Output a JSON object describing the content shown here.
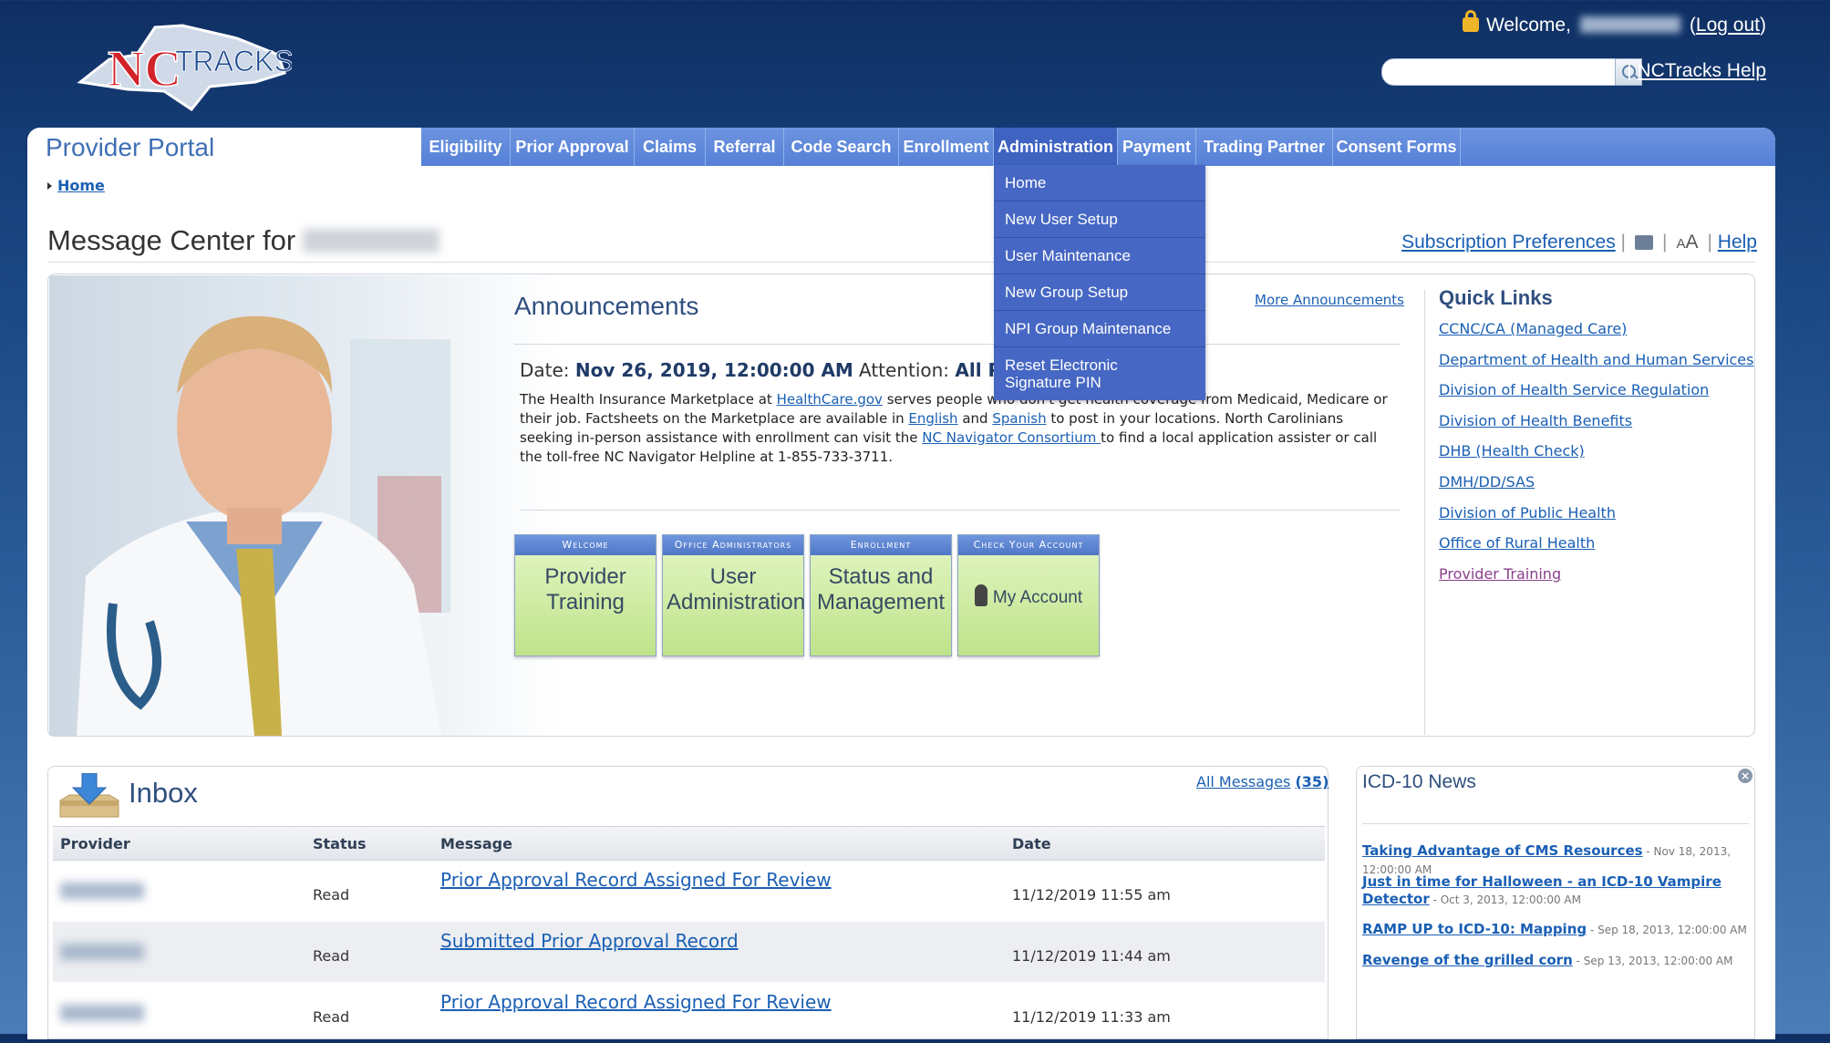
{
  "header": {
    "welcome_label": "Welcome,",
    "logout_label": "Log out",
    "help_label": "NCTracks Help",
    "search_placeholder": ""
  },
  "nav": {
    "portal_title": "Provider Portal",
    "items": [
      {
        "label": "Eligibility"
      },
      {
        "label": "Prior Approval"
      },
      {
        "label": "Claims"
      },
      {
        "label": "Referral"
      },
      {
        "label": "Code Search"
      },
      {
        "label": "Enrollment"
      },
      {
        "label": "Administration"
      },
      {
        "label": "Payment"
      },
      {
        "label": "Trading Partner"
      },
      {
        "label": "Consent Forms"
      }
    ],
    "active": "Administration"
  },
  "dropdown": {
    "items": [
      {
        "label": "Home"
      },
      {
        "label": "New User Setup"
      },
      {
        "label": "User Maintenance"
      },
      {
        "label": "New Group Setup"
      },
      {
        "label": "NPI Group Maintenance"
      },
      {
        "label": "Reset Electronic Signature PIN"
      }
    ]
  },
  "breadcrumb": {
    "home": "Home"
  },
  "page": {
    "title": "Message Center for",
    "subscription_label": "Subscription Preferences",
    "help_label": "Help",
    "text_size_small": "A",
    "text_size_large": "A"
  },
  "announcements": {
    "title": "Announcements",
    "more_label": "More Announcements",
    "date_label": "Date:",
    "date_value": "Nov 26, 2019, 12:00:00 AM",
    "attention_label": "Attention:",
    "attention_value": "All Pr",
    "body_1": "The Health Insurance Marketplace at ",
    "link_healthcare": "HealthCare.gov",
    "body_2": " serves people who don't get health coverage from Medicaid, Medicare or their job. Factsheets on the Marketplace are available in ",
    "link_english": "English",
    "body_3": " and ",
    "link_spanish": "Spanish",
    "body_4": " to post in your locations. North Carolinians seeking in-person assistance with enrollment can visit the ",
    "link_navigator": "NC Navigator Consortium ",
    "body_5": "to find a local application assister or call the toll-free NC Navigator Helpline at 1-855-733-3711."
  },
  "tiles": [
    {
      "header": "Welcome",
      "label_1": "Provider",
      "label_2": "Training"
    },
    {
      "header": "Office Administrators",
      "label_1": "User",
      "label_2": "Administration"
    },
    {
      "header": "Enrollment",
      "label_1": "Status and",
      "label_2": "Management"
    },
    {
      "header": "Check Your Account",
      "label_1": "My Account",
      "label_2": ""
    }
  ],
  "quick_links": {
    "title": "Quick Links",
    "items": [
      {
        "label": "CCNC/CA (Managed Care)"
      },
      {
        "label": "Department of Health and Human Services"
      },
      {
        "label": "Division of Health Service Regulation"
      },
      {
        "label": "Division of Health Benefits"
      },
      {
        "label": "DHB (Health Check)"
      },
      {
        "label": "DMH/DD/SAS"
      },
      {
        "label": "Division of Public Health"
      },
      {
        "label": "Office of Rural Health"
      },
      {
        "label": "Provider Training"
      }
    ]
  },
  "inbox": {
    "title": "Inbox",
    "all_messages_label": "All Messages",
    "all_messages_count": "(35)",
    "columns": [
      "Provider",
      "Status",
      "Message",
      "Date"
    ],
    "rows": [
      {
        "status": "Read",
        "message": "Prior Approval Record Assigned For Review",
        "date": "11/12/2019 11:55 am"
      },
      {
        "status": "Read",
        "message": "Submitted Prior Approval Record",
        "date": "11/12/2019 11:44 am"
      },
      {
        "status": "Read",
        "message": "Prior Approval Record Assigned For Review",
        "date": "11/12/2019 11:33 am"
      }
    ]
  },
  "news": {
    "title": "ICD-10 News",
    "items": [
      {
        "title": "Taking Advantage of CMS Resources",
        "date": " - Nov 18, 2013, 12:00:00 AM"
      },
      {
        "title": "Just in time for Halloween - an ICD-10 Vampire Detector",
        "date": " - Oct 3, 2013, 12:00:00 AM"
      },
      {
        "title": "RAMP UP to ICD-10: Mapping",
        "date": " - Sep 18, 2013, 12:00:00 AM"
      },
      {
        "title": "Revenge of the grilled corn",
        "date": " - Sep 13, 2013, 12:00:00 AM"
      }
    ]
  },
  "colors": {
    "nav_blue": "#5580d6",
    "dropdown_blue": "#4667c3",
    "tile_green": "#bfe38a",
    "link_blue": "#1a5fb4",
    "visited_purple": "#8a3f8a"
  }
}
